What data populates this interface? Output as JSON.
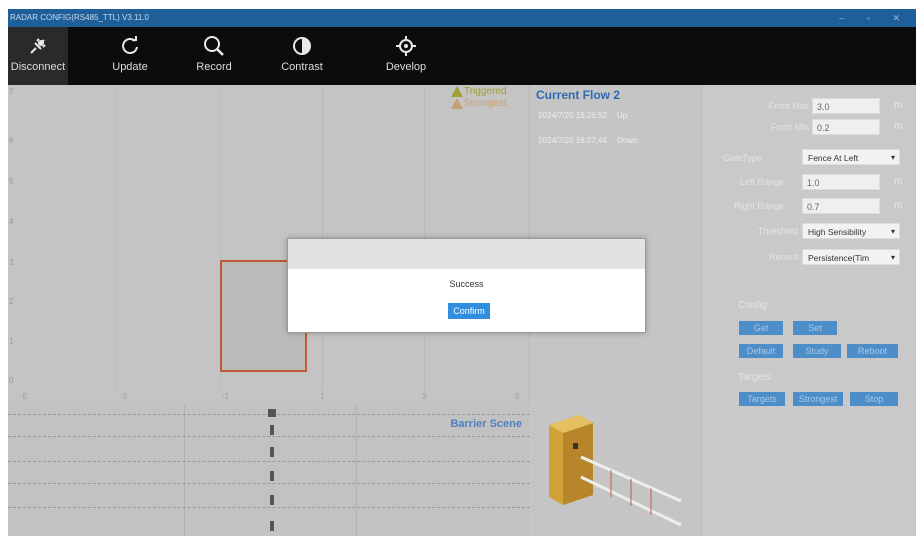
{
  "window": {
    "title": "RADAR CONFIG(RS485_TTL) V3.11.0",
    "controls": "– ▫ ✕"
  },
  "toolbar": {
    "items": [
      {
        "label": "Disconnect"
      },
      {
        "label": "Update"
      },
      {
        "label": "Record"
      },
      {
        "label": "Contrast"
      },
      {
        "label": "Develop"
      }
    ]
  },
  "plot": {
    "y_ticks": [
      "7",
      "6",
      "5",
      "4",
      "3",
      "2",
      "1",
      "0"
    ],
    "x_ticks": [
      "-5",
      "-3",
      "-1",
      "1",
      "3",
      "5"
    ]
  },
  "legend": {
    "triggered": "Triggered",
    "strongest": "Strongest"
  },
  "flow": {
    "title": "Current Flow  2",
    "rows": [
      {
        "time": "2024/7/20 16:26:52",
        "dir": "Up"
      },
      {
        "time": "2024/7/20 16:27:44",
        "dir": "Down"
      }
    ]
  },
  "config": {
    "front_max": {
      "label": "Front  Max",
      "value": "3.0",
      "unit": "m"
    },
    "front_min": {
      "label": "Front  Min",
      "value": "0.2",
      "unit": "m"
    },
    "gate_type": {
      "label": "GateType",
      "value": "Fence At Left"
    },
    "left_range": {
      "label": "Left  Range",
      "value": "1.0",
      "unit": "m"
    },
    "right_range": {
      "label": "Right Range",
      "value": "0.7",
      "unit": "m"
    },
    "threshold": {
      "label": "Threshold",
      "value": "High Sensibility"
    },
    "record": {
      "label": "Record",
      "value": "Persistence(Tim"
    },
    "config_section": "Config",
    "buttons": {
      "get": "Get",
      "set": "Set",
      "default": "Default",
      "study": "Study",
      "reboot": "Reboot"
    },
    "targets_section": "Targets",
    "target_buttons": {
      "targets": "Targets",
      "strongest": "Strongest",
      "stop": "Stop"
    }
  },
  "barrier": {
    "title": "Barrier Scene"
  },
  "dialog": {
    "message": "Success",
    "confirm": "Confirm"
  }
}
